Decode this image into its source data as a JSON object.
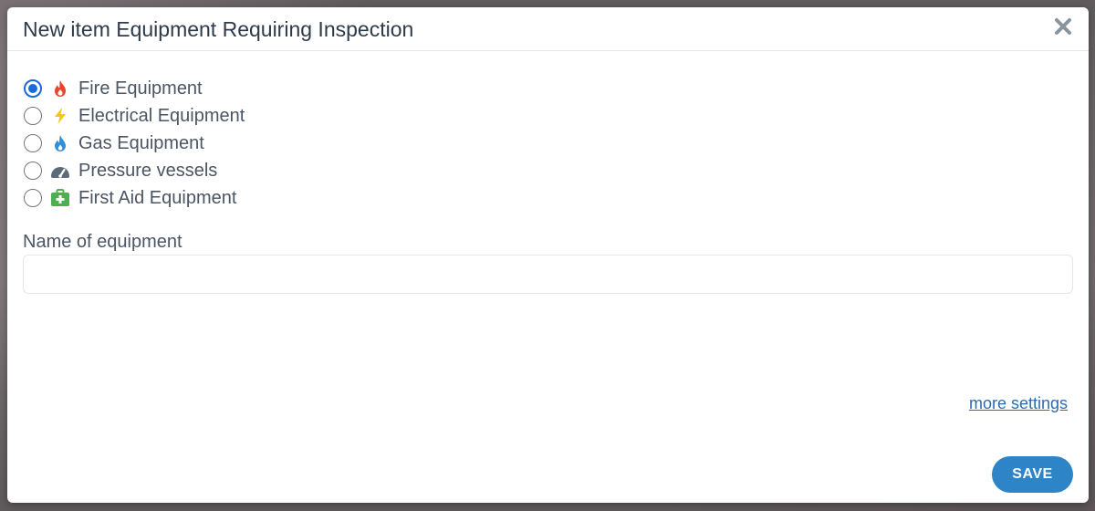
{
  "modal": {
    "title": "New item Equipment Requiring Inspection"
  },
  "options": [
    {
      "label": "Fire Equipment",
      "icon": "fire-icon",
      "color": "#e8452c",
      "checked": true
    },
    {
      "label": "Electrical Equipment",
      "icon": "lightning-icon",
      "color": "#f5c518",
      "checked": false
    },
    {
      "label": "Gas Equipment",
      "icon": "gas-drop-icon",
      "color": "#2f8fd8",
      "checked": false
    },
    {
      "label": "Pressure vessels",
      "icon": "gauge-icon",
      "color": "#5b6b78",
      "checked": false
    },
    {
      "label": "First Aid Equipment",
      "icon": "first-aid-kit-icon",
      "color": "#4caf50",
      "checked": false
    }
  ],
  "name_field": {
    "label": "Name of equipment",
    "value": "",
    "placeholder": ""
  },
  "links": {
    "more_settings": "more settings"
  },
  "buttons": {
    "save": "SAVE"
  },
  "colors": {
    "accent": "#2d84c6",
    "radio_checked": "#1a6ad8",
    "link": "#2b6cb0"
  }
}
